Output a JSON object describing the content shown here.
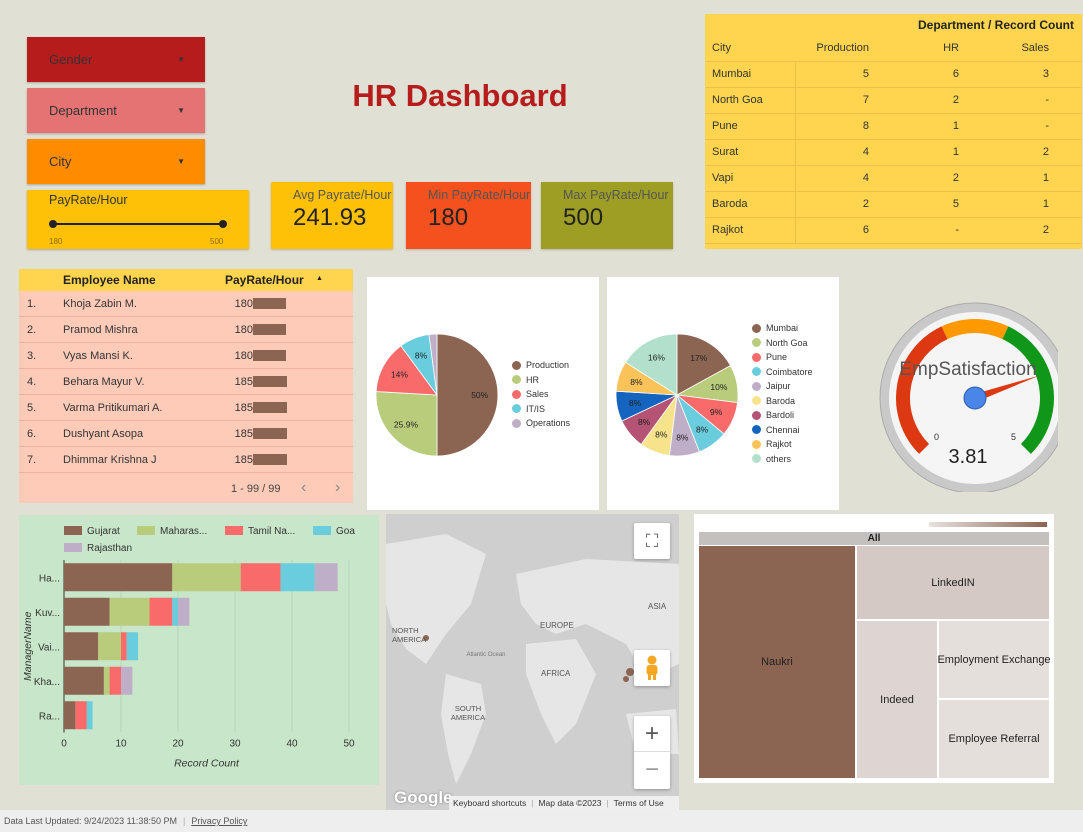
{
  "title": "HR Dashboard",
  "filters": {
    "gender": "Gender",
    "department": "Department",
    "city": "City",
    "payrate": {
      "label": "PayRate/Hour",
      "min": "180",
      "max": "500"
    }
  },
  "kpis": [
    {
      "label": "Avg Payrate/Hour",
      "value": "241.93"
    },
    {
      "label": "Min PayRate/Hour",
      "value": "180"
    },
    {
      "label": "Max PayRate/Hour",
      "value": "500"
    }
  ],
  "crosstab": {
    "title": "Department / Record Count",
    "row_header": "City",
    "columns": [
      "Production",
      "HR",
      "Sales"
    ],
    "rows": [
      {
        "city": "Mumbai",
        "values": [
          "5",
          "6",
          "3"
        ]
      },
      {
        "city": "North Goa",
        "values": [
          "7",
          "2",
          "-"
        ]
      },
      {
        "city": "Pune",
        "values": [
          "8",
          "1",
          "-"
        ]
      },
      {
        "city": "Surat",
        "values": [
          "4",
          "1",
          "2"
        ]
      },
      {
        "city": "Vapi",
        "values": [
          "4",
          "2",
          "1"
        ]
      },
      {
        "city": "Baroda",
        "values": [
          "2",
          "5",
          "1"
        ]
      },
      {
        "city": "Rajkot",
        "values": [
          "6",
          "-",
          "2"
        ]
      }
    ]
  },
  "employees": {
    "col_name": "Employee Name",
    "col_pay": "PayRate/Hour",
    "sort_icon": "sort-asc-icon",
    "pagination": "1 - 99 / 99",
    "max_pay": 500,
    "rows": [
      {
        "idx": "1.",
        "name": "Khoja Zabin M.",
        "pay": "180"
      },
      {
        "idx": "2.",
        "name": "Pramod Mishra",
        "pay": "180"
      },
      {
        "idx": "3.",
        "name": "Vyas Mansi K.",
        "pay": "180"
      },
      {
        "idx": "4.",
        "name": "Behara Mayur V.",
        "pay": "185"
      },
      {
        "idx": "5.",
        "name": "Varma Pritikumari A.",
        "pay": "185"
      },
      {
        "idx": "6.",
        "name": "Dushyant Asopa",
        "pay": "185"
      },
      {
        "idx": "7.",
        "name": "Dhimmar Krishna J",
        "pay": "185"
      }
    ]
  },
  "gauge": {
    "title": "EmpSatisfaction",
    "min": "0",
    "max": "5",
    "value": "3.81",
    "value_num": 3.81
  },
  "map": {
    "labels": [
      "ASIA",
      "EUROPE",
      "NORTH AMERICA",
      "AFRICA",
      "SOUTH AMERICA",
      "Atlantic Ocean"
    ],
    "google": "Google",
    "footer": [
      "Keyboard shortcuts",
      "Map data ©2023",
      "Terms of Use"
    ],
    "zoom_in": "+",
    "zoom_out": "−"
  },
  "treemap": {
    "root": "All",
    "items": [
      "Naukri",
      "LinkedIN",
      "Indeed",
      "Employment Exchange",
      "Employee Referral"
    ]
  },
  "footer": {
    "updated": "Data Last Updated: 9/24/2023 11:38:50 PM",
    "privacy": "Privacy Policy"
  },
  "colors": {
    "gender": "#b71c1c",
    "department": "#e57373",
    "city": "#ff8c00",
    "payrate": "#ffc107",
    "avg": "#ffc107",
    "min": "#f4511e",
    "max": "#9e9d24"
  },
  "chart_data": [
    {
      "type": "pie",
      "categories": [
        "Production",
        "HR",
        "Sales",
        "IT/IS",
        "Operations"
      ],
      "values": [
        50,
        25.9,
        14,
        8,
        2.1
      ],
      "labels": [
        "50%",
        "25.9%",
        "14%",
        "8%",
        ""
      ],
      "colors": [
        "#8b6452",
        "#b9cc7c",
        "#f96b6b",
        "#69cddd",
        "#bfaec8"
      ]
    },
    {
      "type": "pie",
      "categories": [
        "Mumbai",
        "North Goa",
        "Pune",
        "Coimbatore",
        "Jaipur",
        "Baroda",
        "Bardoli",
        "Chennai",
        "Rajkot",
        "others"
      ],
      "values": [
        17,
        10,
        9,
        8,
        8,
        8,
        8,
        8,
        8,
        16
      ],
      "labels": [
        "17%",
        "10%",
        "9%",
        "8%",
        "8%",
        "8%",
        "8%",
        "8%",
        "8%",
        "16%"
      ],
      "colors": [
        "#8b6452",
        "#b9cc7c",
        "#f96b6b",
        "#69cddd",
        "#bfaec8",
        "#f6e38b",
        "#b55375",
        "#1565c0",
        "#f9c35a",
        "#b2e0cc"
      ]
    },
    {
      "type": "bar",
      "orientation": "horizontal",
      "stacked": true,
      "categories": [
        "Ha...",
        "Kuv...",
        "Vai...",
        "Kha...",
        "Ra..."
      ],
      "series": [
        {
          "name": "Gujarat",
          "values": [
            19,
            8,
            6,
            7,
            2
          ],
          "color": "#8b6452"
        },
        {
          "name": "Maharas...",
          "values": [
            12,
            7,
            4,
            1,
            0
          ],
          "color": "#b9cc7c"
        },
        {
          "name": "Tamil Na...",
          "values": [
            7,
            4,
            1,
            2,
            2
          ],
          "color": "#f96b6b"
        },
        {
          "name": "Goa",
          "values": [
            6,
            1,
            2,
            0,
            1
          ],
          "color": "#69cddd"
        },
        {
          "name": "Rajasthan",
          "values": [
            4,
            2,
            0,
            2,
            0
          ],
          "color": "#bfaec8"
        }
      ],
      "xlabel": "Record Count",
      "ylabel": "ManagerName",
      "xlim": [
        0,
        50
      ],
      "xticks": [
        "0",
        "10",
        "20",
        "30",
        "40",
        "50"
      ]
    }
  ]
}
